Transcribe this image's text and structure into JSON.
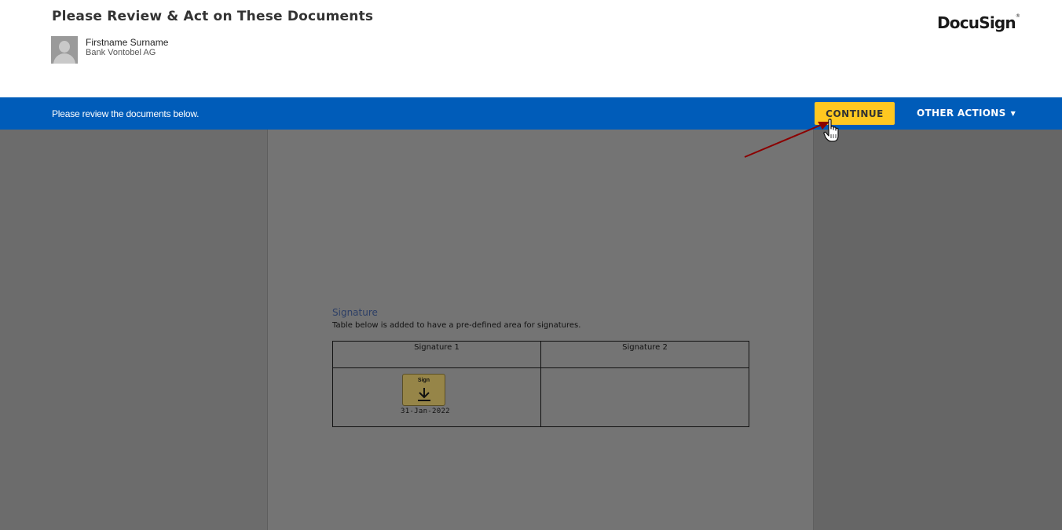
{
  "header": {
    "title": "Please Review & Act on These Documents",
    "sender_name": "Firstname Surname",
    "sender_org": "Bank Vontobel AG",
    "logo_text": "DocuSign"
  },
  "action_bar": {
    "message": "Please review the documents below.",
    "continue_label": "CONTINUE",
    "other_actions_label": "OTHER ACTIONS",
    "bar_color": "#005cb9",
    "continue_color": "#ffc820"
  },
  "document": {
    "section_heading": "Signature",
    "section_description": "Table below is added to have a pre-defined area for signatures.",
    "table": {
      "headers": [
        "Signature 1",
        "Signature 2"
      ]
    },
    "sign_tag": {
      "label": "Sign",
      "icon": "download-arrow-icon",
      "date": "31-Jan-2022"
    }
  },
  "icons": {
    "avatar": "person-silhouette-icon",
    "caret": "caret-down-icon",
    "cursor": "hand-pointer-cursor",
    "annotation": "red-arrow-annotation"
  }
}
